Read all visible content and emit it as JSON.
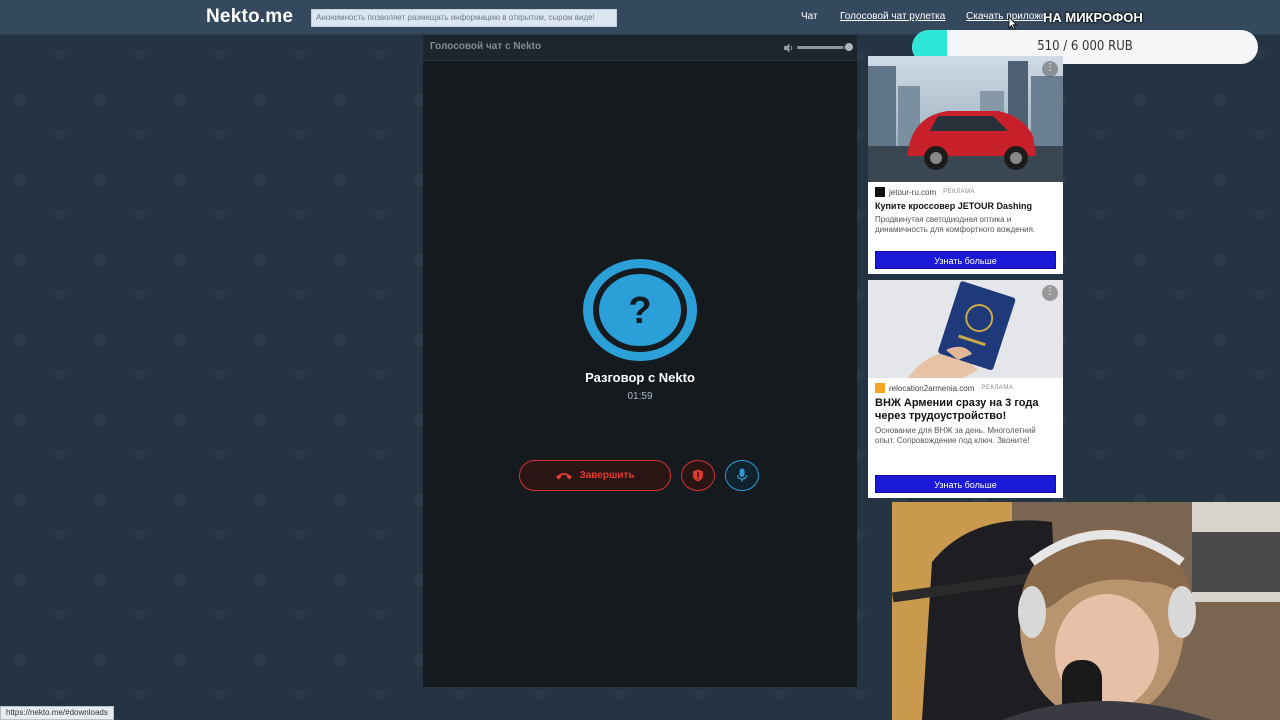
{
  "navbar": {
    "logo": "Nekto.me",
    "notice": "Анонимность позволяет размещать информацию в открытом, сыром виде!",
    "links": {
      "chat": "Чат",
      "voice_roulette": "Голосовой чат рулетка",
      "download": "Скачать приложение"
    }
  },
  "donation": {
    "title": "НА МИКРОФОН",
    "progress_text": "510 / 6 000 RUB",
    "current": 510,
    "goal": 6000,
    "fill_color": "#2ee6d6"
  },
  "chat": {
    "header_title": "Голосовой чат с Nekto",
    "volume_level": 0.85,
    "partner_name": "Разговор с Nekto",
    "timer": "01:59",
    "end_button_label": "Завершить",
    "avatar_icon": "question-mark-icon",
    "accent_color": "#2a9fd8",
    "danger_color": "#d2322d"
  },
  "ads": [
    {
      "domain": "jetour-ru.com",
      "label": "РЕКЛАМА",
      "title": "Купите кроссовер JETOUR Dashing",
      "description": "Продвинутая светодиодная оптика и динамичность для комфортного вождения.",
      "cta": "Узнать больше",
      "image": "red-suv-city-photo"
    },
    {
      "domain": "relocation2armenia.com",
      "label": "РЕКЛАМА",
      "title": "ВНЖ Армении сразу на 3 года через трудоустройство!",
      "description": "Основание для ВНЖ за день. Многолетний опыт. Сопровождение под ключ. Звоните!",
      "cta": "Узнать больше",
      "image": "passport-in-hand-photo"
    }
  ],
  "status_bar": {
    "url": "https://nekto.me/#downloads"
  }
}
